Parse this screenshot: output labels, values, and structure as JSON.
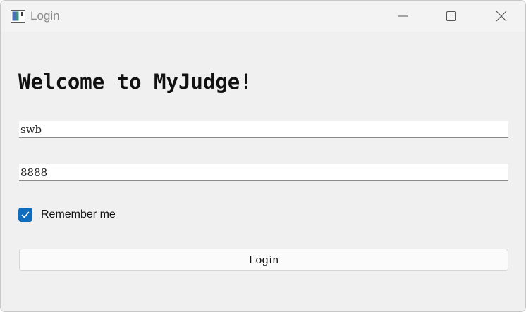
{
  "window": {
    "title": "Login",
    "app_icon": "window-app-icon",
    "controls": [
      "minimize-icon",
      "maximize-icon",
      "close-icon"
    ]
  },
  "main": {
    "heading": "Welcome to MyJudge!",
    "username_value": "swb",
    "password_value": "8888",
    "remember_label": "Remember me",
    "remember_checked": true,
    "login_label": "Login"
  },
  "colors": {
    "accent": "#0f6cbd",
    "window_bg": "#f0f0f0"
  }
}
